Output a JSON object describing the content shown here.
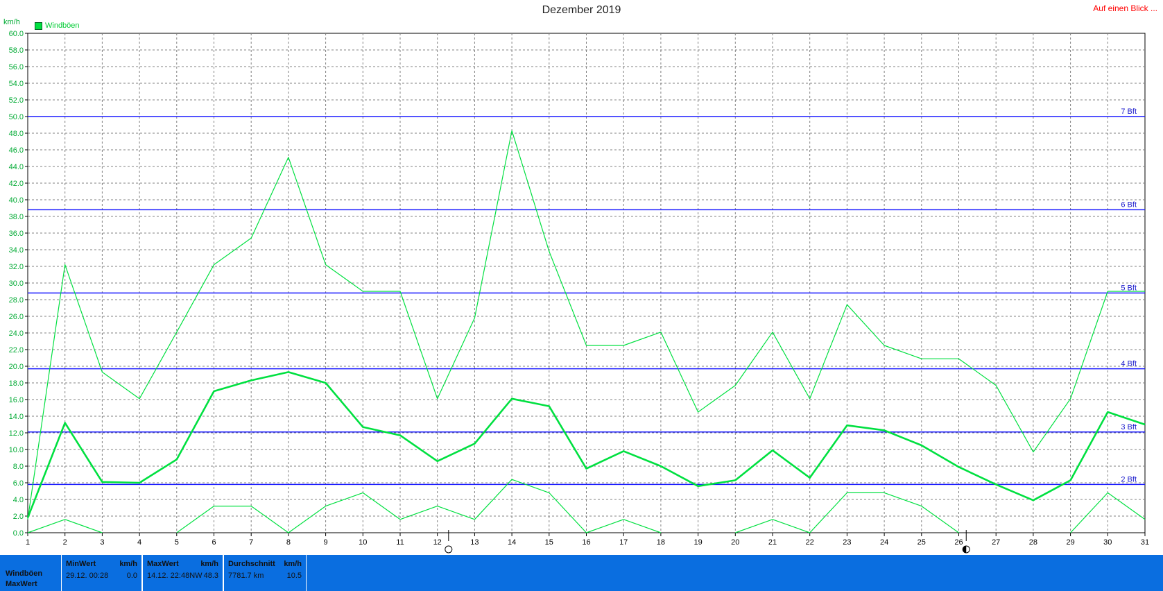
{
  "header": {
    "title": "Dezember 2019",
    "link": "Auf einen Blick ..."
  },
  "unit_label": "km/h",
  "legend": {
    "label": "Windböen",
    "color": "#00e040"
  },
  "colors": {
    "series": "#00e040",
    "grid": "#808080",
    "bft": "#1a1aff",
    "footer": "#0a6ee0"
  },
  "moon_icons": [
    "new-moon-icon",
    "last-quarter-moon-icon"
  ],
  "chart_data": {
    "type": "line",
    "title": "Dezember 2019",
    "ylabel": "km/h",
    "xlabel": "",
    "ylim": [
      0,
      60
    ],
    "yticks": [
      0.0,
      2.0,
      4.0,
      6.0,
      8.0,
      10.0,
      12.0,
      14.0,
      16.0,
      18.0,
      20.0,
      22.0,
      24.0,
      26.0,
      28.0,
      30.0,
      32.0,
      34.0,
      36.0,
      38.0,
      40.0,
      42.0,
      44.0,
      46.0,
      48.0,
      50.0,
      52.0,
      54.0,
      56.0,
      58.0,
      60.0
    ],
    "x": [
      1,
      2,
      3,
      4,
      5,
      6,
      7,
      8,
      9,
      10,
      11,
      12,
      13,
      14,
      15,
      16,
      17,
      18,
      19,
      20,
      21,
      22,
      23,
      24,
      25,
      26,
      27,
      28,
      29,
      30,
      31
    ],
    "grid": true,
    "legend_position": "top-left",
    "series": [
      {
        "name": "Windböen",
        "role": "avg",
        "values": [
          1.8,
          13.2,
          6.1,
          6.0,
          8.8,
          17.0,
          18.3,
          19.3,
          18.0,
          12.7,
          11.7,
          8.6,
          10.7,
          16.1,
          15.2,
          7.7,
          9.8,
          8.0,
          5.6,
          6.3,
          9.9,
          6.6,
          12.9,
          12.3,
          10.5,
          7.9,
          5.8,
          3.9,
          6.3,
          14.5,
          13.0
        ]
      },
      {
        "role": "max",
        "values": [
          1.6,
          32.2,
          19.3,
          16.1,
          24.1,
          32.2,
          35.4,
          45.1,
          32.2,
          29.0,
          29.0,
          16.1,
          25.8,
          48.3,
          33.8,
          22.5,
          22.5,
          24.1,
          14.5,
          17.7,
          24.1,
          16.1,
          27.4,
          22.5,
          20.9,
          20.9,
          17.7,
          9.7,
          16.1,
          29.0,
          29.0
        ]
      },
      {
        "role": "min",
        "values": [
          0.0,
          1.6,
          0.0,
          null,
          0.0,
          3.2,
          3.2,
          0.0,
          3.2,
          4.8,
          1.6,
          3.2,
          1.6,
          6.4,
          4.8,
          0.0,
          1.6,
          0.0,
          null,
          0.0,
          1.6,
          0.0,
          4.8,
          4.8,
          3.2,
          0.0,
          null,
          null,
          0.0,
          4.8,
          1.6
        ]
      }
    ],
    "reference_lines": [
      {
        "label": "2 Bft",
        "value": 5.8
      },
      {
        "label": "3 Bft",
        "value": 12.1
      },
      {
        "label": "4 Bft",
        "value": 19.7
      },
      {
        "label": "5 Bft",
        "value": 28.8
      },
      {
        "label": "6 Bft",
        "value": 38.8
      },
      {
        "label": "7 Bft",
        "value": 50.0
      }
    ],
    "moon_markers": [
      {
        "x": 12.3,
        "icon": "new-moon"
      },
      {
        "x": 26.2,
        "icon": "last-quarter"
      }
    ]
  },
  "footer": {
    "row_labels": [
      "Windböen",
      "MaxWert"
    ],
    "min": {
      "header": "MinWert",
      "unit": "km/h",
      "date": "29.12.",
      "time": "00:28",
      "value": "0.0"
    },
    "max": {
      "header": "MaxWert",
      "unit": "km/h",
      "date": "14.12.",
      "time": "22:48",
      "dir": "NW",
      "value": "48.3"
    },
    "avg": {
      "header": "Durchschnitt",
      "unit": "km/h",
      "distance": "7781.7 km",
      "value": "10.5"
    }
  }
}
